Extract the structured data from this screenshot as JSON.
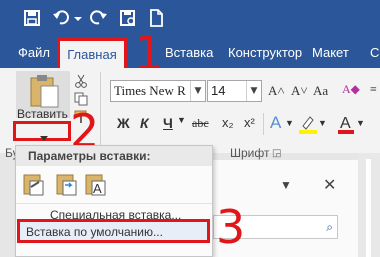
{
  "colors": {
    "ribbon_blue": "#2b579a",
    "annotation_red": "#e0161b",
    "ribbon_bg": "#f3f3f3"
  },
  "quick_access": {
    "icons": [
      "save-icon",
      "undo-icon",
      "dropdown-icon",
      "redo-icon",
      "print-preview-icon",
      "new-document-icon"
    ]
  },
  "tabs": [
    {
      "label": "Файл"
    },
    {
      "label": "Главная",
      "selected": true
    },
    {
      "label": "Вставка"
    },
    {
      "label": "Конструктор"
    },
    {
      "label": "Макет"
    },
    {
      "label": "С"
    }
  ],
  "ribbon": {
    "paste_label": "Вставить",
    "font_name": "Times New R",
    "font_size": "14",
    "font_group_label": "Шрифт",
    "clipboard_group_label_partial": "Бу",
    "format_buttons": [
      "Ж",
      "К",
      "Ч",
      "abc",
      "x₂",
      "x²"
    ]
  },
  "paste_menu": {
    "header": "Параметры вставки:",
    "option_icons": [
      "keep-source-formatting-icon",
      "merge-formatting-icon",
      "keep-text-only-icon"
    ],
    "special_paste": "Специальная вставка...",
    "default_paste": "Вставка по умолчанию..."
  },
  "annotations": [
    "1",
    "2",
    "3"
  ]
}
